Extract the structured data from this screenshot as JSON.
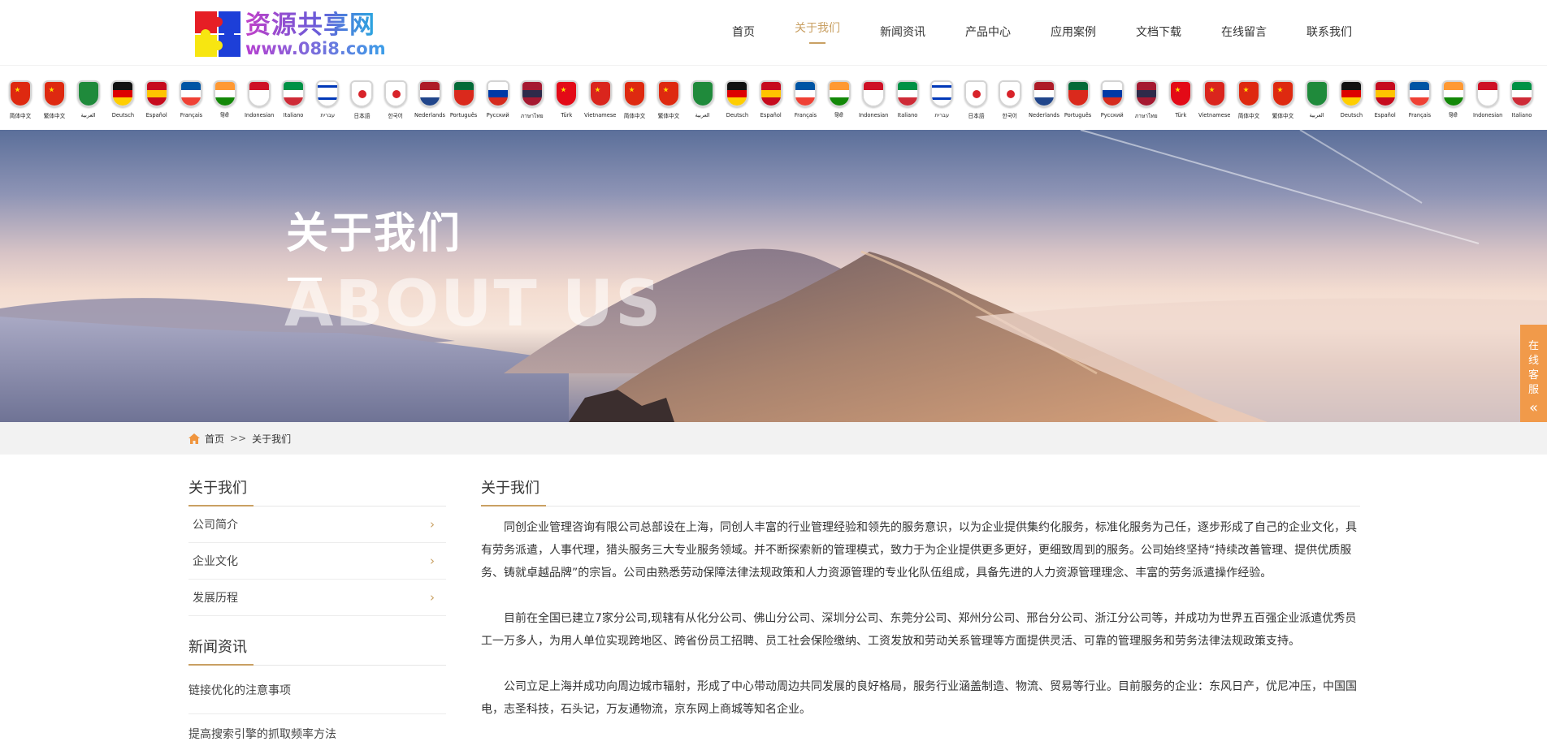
{
  "header": {
    "logo_title": "资源共享网",
    "logo_url": "www.08i8.com",
    "nav": [
      {
        "label": "首页",
        "active": false
      },
      {
        "label": "关于我们",
        "active": true
      },
      {
        "label": "新闻资讯",
        "active": false
      },
      {
        "label": "产品中心",
        "active": false
      },
      {
        "label": "应用案例",
        "active": false
      },
      {
        "label": "文档下载",
        "active": false
      },
      {
        "label": "在线留言",
        "active": false
      },
      {
        "label": "联系我们",
        "active": false
      }
    ]
  },
  "languages": [
    {
      "name": "简体中文",
      "flag": "cn"
    },
    {
      "name": "繁体中文",
      "flag": "hk"
    },
    {
      "name": "العربية",
      "flag": "sa"
    },
    {
      "name": "Deutsch",
      "flag": "de"
    },
    {
      "name": "Español",
      "flag": "es"
    },
    {
      "name": "Français",
      "flag": "fr"
    },
    {
      "name": "हिंदी",
      "flag": "in"
    },
    {
      "name": "Indonesian",
      "flag": "id"
    },
    {
      "name": "Italiano",
      "flag": "it"
    },
    {
      "name": "עברית",
      "flag": "il"
    },
    {
      "name": "日本語",
      "flag": "jp"
    },
    {
      "name": "한국어",
      "flag": "kr"
    },
    {
      "name": "Nederlands",
      "flag": "nl"
    },
    {
      "name": "Português",
      "flag": "pt"
    },
    {
      "name": "Русский",
      "flag": "ru"
    },
    {
      "name": "ภาษาไทย",
      "flag": "th"
    },
    {
      "name": "Türk",
      "flag": "tr"
    },
    {
      "name": "Vietnamese",
      "flag": "vn"
    },
    {
      "name": "简体中文",
      "flag": "cn"
    },
    {
      "name": "繁体中文",
      "flag": "hk"
    },
    {
      "name": "العربية",
      "flag": "sa"
    },
    {
      "name": "Deutsch",
      "flag": "de"
    },
    {
      "name": "Español",
      "flag": "es"
    },
    {
      "name": "Français",
      "flag": "fr"
    },
    {
      "name": "हिंदी",
      "flag": "in"
    },
    {
      "name": "Indonesian",
      "flag": "id"
    },
    {
      "name": "Italiano",
      "flag": "it"
    },
    {
      "name": "עברית",
      "flag": "il"
    },
    {
      "name": "日本語",
      "flag": "jp"
    },
    {
      "name": "한국어",
      "flag": "kr"
    },
    {
      "name": "Nederlands",
      "flag": "nl"
    },
    {
      "name": "Português",
      "flag": "pt"
    },
    {
      "name": "Русский",
      "flag": "ru"
    },
    {
      "name": "ภาษาไทย",
      "flag": "th"
    },
    {
      "name": "Türk",
      "flag": "tr"
    },
    {
      "name": "Vietnamese",
      "flag": "vn"
    },
    {
      "name": "简体中文",
      "flag": "cn"
    },
    {
      "name": "繁体中文",
      "flag": "hk"
    },
    {
      "name": "العربية",
      "flag": "sa"
    },
    {
      "name": "Deutsch",
      "flag": "de"
    },
    {
      "name": "Español",
      "flag": "es"
    },
    {
      "name": "Français",
      "flag": "fr"
    },
    {
      "name": "हिंदी",
      "flag": "in"
    },
    {
      "name": "Indonesian",
      "flag": "id"
    },
    {
      "name": "Italiano",
      "flag": "it"
    }
  ],
  "flag_colors": {
    "cn": [
      "#de2910",
      "#de2910",
      "#de2910"
    ],
    "hk": [
      "#de2910",
      "#de2910",
      "#de2910"
    ],
    "sa": [
      "#1f8a3b",
      "#1f8a3b",
      "#1f8a3b"
    ],
    "de": [
      "#111111",
      "#dd0000",
      "#ffce00"
    ],
    "es": [
      "#c60b1e",
      "#ffc400",
      "#c60b1e"
    ],
    "fr": [
      "#0055a4",
      "#ffffff",
      "#ef4135"
    ],
    "in": [
      "#ff9933",
      "#ffffff",
      "#138808"
    ],
    "id": [
      "#ce1126",
      "#ffffff",
      "#ffffff"
    ],
    "it": [
      "#009246",
      "#ffffff",
      "#ce2b37"
    ],
    "il": [
      "#ffffff",
      "#ffffff",
      "#ffffff"
    ],
    "jp": [
      "#ffffff",
      "#ffffff",
      "#ffffff"
    ],
    "kr": [
      "#ffffff",
      "#ffffff",
      "#ffffff"
    ],
    "nl": [
      "#ae1c28",
      "#ffffff",
      "#21468b"
    ],
    "pt": [
      "#046a38",
      "#da291c",
      "#da291c"
    ],
    "ru": [
      "#ffffff",
      "#0039a6",
      "#d52b1e"
    ],
    "th": [
      "#a51931",
      "#2d2a4a",
      "#a51931"
    ],
    "tr": [
      "#e30a17",
      "#e30a17",
      "#e30a17"
    ],
    "vn": [
      "#da251d",
      "#da251d",
      "#da251d"
    ]
  },
  "banner": {
    "title": "关于我们",
    "subtitle": "ABOUT US"
  },
  "service": {
    "label": "在线客服",
    "arrow": "«"
  },
  "breadcrumb": {
    "home": "首页",
    "separator": ">>",
    "current": "关于我们"
  },
  "sidebar": {
    "title": "关于我们",
    "items": [
      {
        "label": "公司简介"
      },
      {
        "label": "企业文化"
      },
      {
        "label": "发展历程"
      }
    ],
    "news_title": "新闻资讯",
    "news": [
      {
        "label": "链接优化的注意事项"
      },
      {
        "label": "提高搜索引擎的抓取频率方法"
      }
    ]
  },
  "main": {
    "title": "关于我们",
    "paragraphs": [
      "同创企业管理咨询有限公司总部设在上海，同创人丰富的行业管理经验和领先的服务意识，以为企业提供集约化服务，标准化服务为己任，逐步形成了自己的企业文化，具有劳务派遣，人事代理，猎头服务三大专业服务领域。并不断探索新的管理模式，致力于为企业提供更多更好，更细致周到的服务。公司始终坚持“持续改善管理、提供优质服务、铸就卓越品牌”的宗旨。公司由熟悉劳动保障法律法规政策和人力资源管理的专业化队伍组成，具备先进的人力资源管理理念、丰富的劳务派遣操作经验。",
      "目前在全国已建立7家分公司,现辖有从化分公司、佛山分公司、深圳分公司、东莞分公司、郑州分公司、邢台分公司、浙江分公司等，并成功为世界五百强企业派遣优秀员工一万多人，为用人单位实现跨地区、跨省份员工招聘、员工社会保险缴纳、工资发放和劳动关系管理等方面提供灵活、可靠的管理服务和劳务法律法规政策支持。",
      "公司立足上海并成功向周边城市辐射，形成了中心带动周边共同发展的良好格局，服务行业涵盖制造、物流、贸易等行业。目前服务的企业：东风日产，优尼冲压，中国国电，志圣科技，石头记，万友通物流，京东网上商城等知名企业。"
    ]
  },
  "colors": {
    "accent": "#c9a063",
    "service_bg": "#f19a4a",
    "crumb_bg": "#f2f2f2"
  }
}
